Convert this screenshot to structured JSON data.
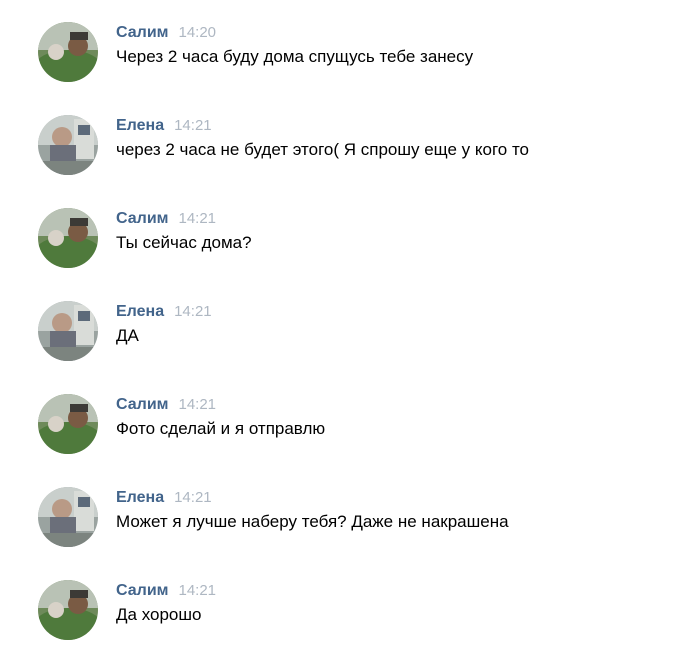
{
  "messages": [
    {
      "author": "Салим",
      "time": "14:20",
      "text": "Через 2 часа буду дома спущусь тебе занесу",
      "avatar": "salim"
    },
    {
      "author": "Елена",
      "time": "14:21",
      "text": "через 2 часа не будет этого( Я спрошу еще у кого то",
      "avatar": "elena"
    },
    {
      "author": "Салим",
      "time": "14:21",
      "text": "Ты сейчас дома?",
      "avatar": "salim"
    },
    {
      "author": "Елена",
      "time": "14:21",
      "text": "ДА",
      "avatar": "elena"
    },
    {
      "author": "Салим",
      "time": "14:21",
      "text": "Фото сделай и я отправлю",
      "avatar": "salim"
    },
    {
      "author": "Елена",
      "time": "14:21",
      "text": "Может я лучше наберу тебя? Даже не накрашена",
      "avatar": "elena"
    },
    {
      "author": "Салим",
      "time": "14:21",
      "text": "Да хорошо",
      "avatar": "salim"
    }
  ],
  "colors": {
    "author_name": "#42648b",
    "timestamp": "#aeb7c2",
    "message_text": "#000000"
  }
}
